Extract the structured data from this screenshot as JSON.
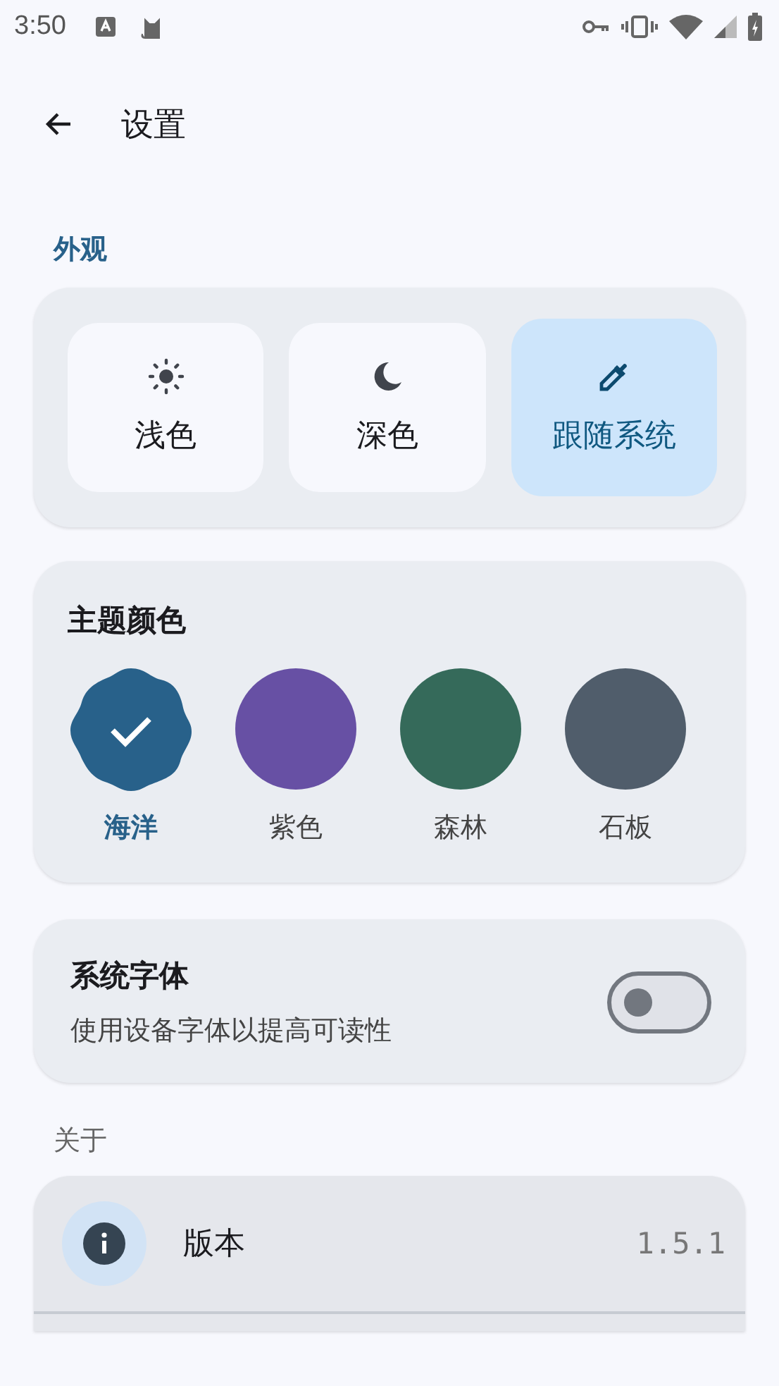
{
  "status_bar": {
    "time": "3:50"
  },
  "top_bar": {
    "title": "设置"
  },
  "appearance": {
    "heading": "外观",
    "modes": [
      {
        "label": "浅色",
        "selected": false
      },
      {
        "label": "深色",
        "selected": false
      },
      {
        "label": "跟随系统",
        "selected": true
      }
    ]
  },
  "theme_color": {
    "title": "主题颜色",
    "swatches": [
      {
        "label": "海洋",
        "color": "#28618a",
        "selected": true
      },
      {
        "label": "紫色",
        "color": "#6750a4",
        "selected": false
      },
      {
        "label": "森林",
        "color": "#356a5a",
        "selected": false
      },
      {
        "label": "石板",
        "color": "#505d6b",
        "selected": false
      }
    ]
  },
  "system_font": {
    "title": "系统字体",
    "description": "使用设备字体以提高可读性",
    "on": false
  },
  "about": {
    "heading": "关于",
    "items": [
      {
        "label": "版本",
        "value": "1.5.1"
      }
    ]
  }
}
